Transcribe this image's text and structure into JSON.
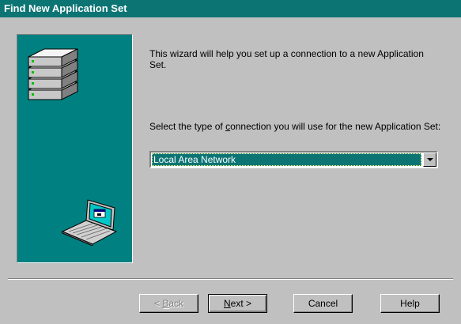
{
  "window": {
    "title": "Find New Application Set"
  },
  "wizard": {
    "intro_text": "This wizard will help you set up a connection to a new Application Set.",
    "prompt_before": "Select the type of ",
    "prompt_accel": "c",
    "prompt_after": "onnection you will use for the new Application Set:",
    "connection_type_value": "Local Area Network"
  },
  "buttons": {
    "back_accel": "B",
    "back_rest": "ack",
    "back_prefix": "< ",
    "next_accel": "N",
    "next_rest": "ext >",
    "cancel": "Cancel",
    "help": "Help"
  },
  "colors": {
    "title_bar": "#0d7474",
    "art_panel": "#008080",
    "dialog_face": "#c0c0c0",
    "selection": "#0d7474"
  },
  "icons": [
    "server-stack-icon",
    "laptop-icon",
    "dropdown-arrow-icon"
  ]
}
